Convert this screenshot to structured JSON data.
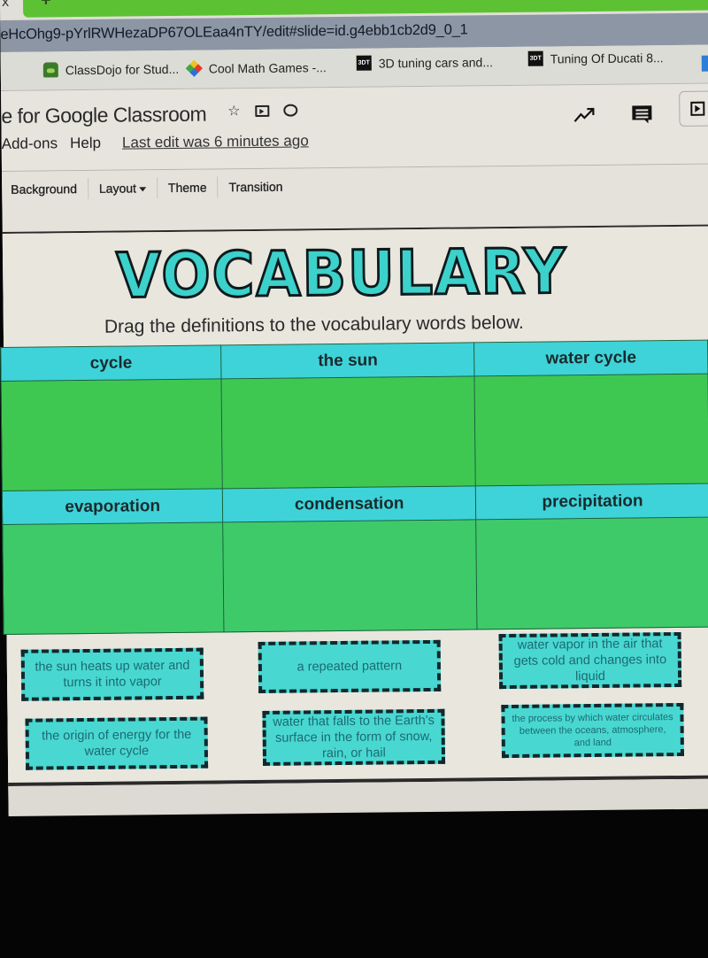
{
  "browser": {
    "url": "eHcOhg9-pYrlRWHezaDP67OLEaa4nTY/edit#slide=id.g4ebb1cb2d9_0_1",
    "bookmarks": [
      {
        "label": "ClassDojo for Stud...",
        "icon": "classdojo-icon"
      },
      {
        "label": "Cool Math Games -...",
        "icon": "coolmath-icon"
      },
      {
        "label": "3D tuning cars and...",
        "icon": "3dtuning-icon"
      },
      {
        "label": "Tuning Of Ducati 8...",
        "icon": "3dtuning-icon"
      }
    ],
    "new_tab_symbol": "+",
    "close_tab_symbol": "x"
  },
  "docs": {
    "title": "e for Google Classroom",
    "menu": [
      "Add-ons",
      "Help"
    ],
    "last_edit": "Last edit was 6 minutes ago",
    "title_icons": [
      "star-icon",
      "move-to-folder-icon",
      "cloud-status-icon"
    ],
    "right_icons": [
      "activity-trend-icon",
      "comments-icon",
      "present-icon"
    ]
  },
  "toolbar": {
    "items": [
      "Background",
      "Layout",
      "Theme",
      "Transition"
    ]
  },
  "slide": {
    "title": "VOCABULARY",
    "subtitle": "Drag the definitions to the vocabulary words below.",
    "colors": {
      "title": "#3cd1cb",
      "header_cells": "#3ed3d8",
      "drop_cells": "#3ec852",
      "cards": "#48d8d1"
    },
    "table": {
      "row1": [
        "cycle",
        "the sun",
        "water cycle"
      ],
      "row2": [
        "evaporation",
        "condensation",
        "precipitation"
      ]
    },
    "cards": [
      "the sun heats up water and turns it into vapor",
      "a repeated pattern",
      "water vapor in the air that gets cold and changes into liquid",
      "the origin of energy for the water cycle",
      "water that falls to the Earth's surface in the form of snow, rain, or hail",
      "the process by which water circulates between the oceans, atmosphere, and land"
    ]
  }
}
